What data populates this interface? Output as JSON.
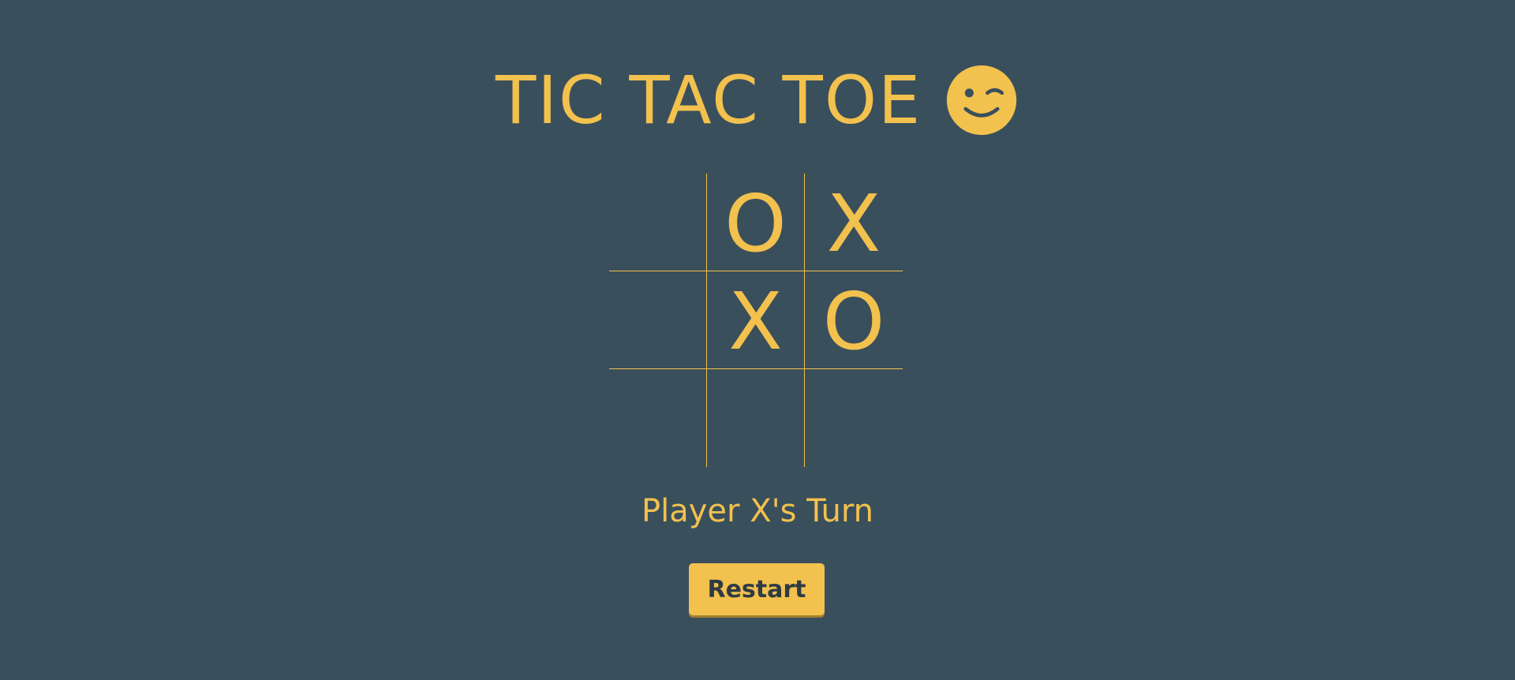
{
  "title": "TIC TAC TOE",
  "title_icon": "wink-face-icon",
  "board": {
    "cells": [
      "",
      "O",
      "X",
      "",
      "X",
      "O",
      "",
      "",
      ""
    ]
  },
  "status": "Player X's Turn",
  "restart_label": "Restart",
  "colors": {
    "background": "#3a4f5c",
    "accent": "#f2c14e",
    "button_text": "#2f3b44"
  }
}
